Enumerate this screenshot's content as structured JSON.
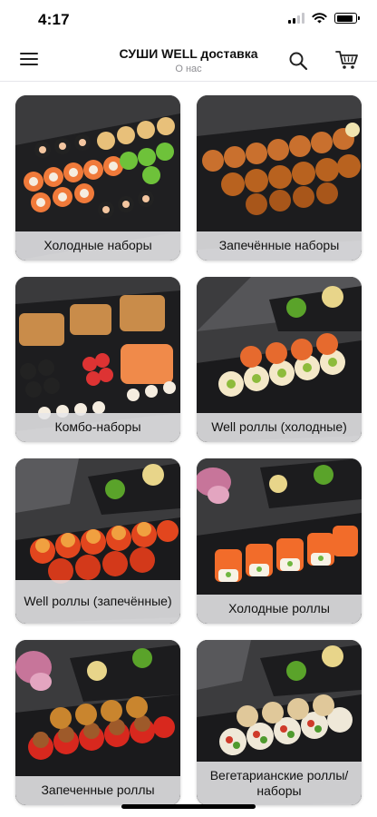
{
  "status_bar": {
    "time": "4:17"
  },
  "header": {
    "title": "СУШИ WELL доставка",
    "subtitle": "О нас"
  },
  "categories": [
    {
      "label": "Холодные наборы"
    },
    {
      "label": "Запечённые наборы"
    },
    {
      "label": "Комбо-наборы"
    },
    {
      "label": "Well роллы (холодные)"
    },
    {
      "label": "Well роллы (запечённые)"
    },
    {
      "label": "Холодные роллы"
    },
    {
      "label": "Запеченные роллы"
    },
    {
      "label": "Вегетарианские роллы/наборы"
    }
  ],
  "icons": {
    "menu": "hamburger-menu-icon",
    "search": "search-icon",
    "cart": "cart-icon",
    "signal": "cellular-signal-icon",
    "wifi": "wifi-icon",
    "battery": "battery-icon"
  }
}
